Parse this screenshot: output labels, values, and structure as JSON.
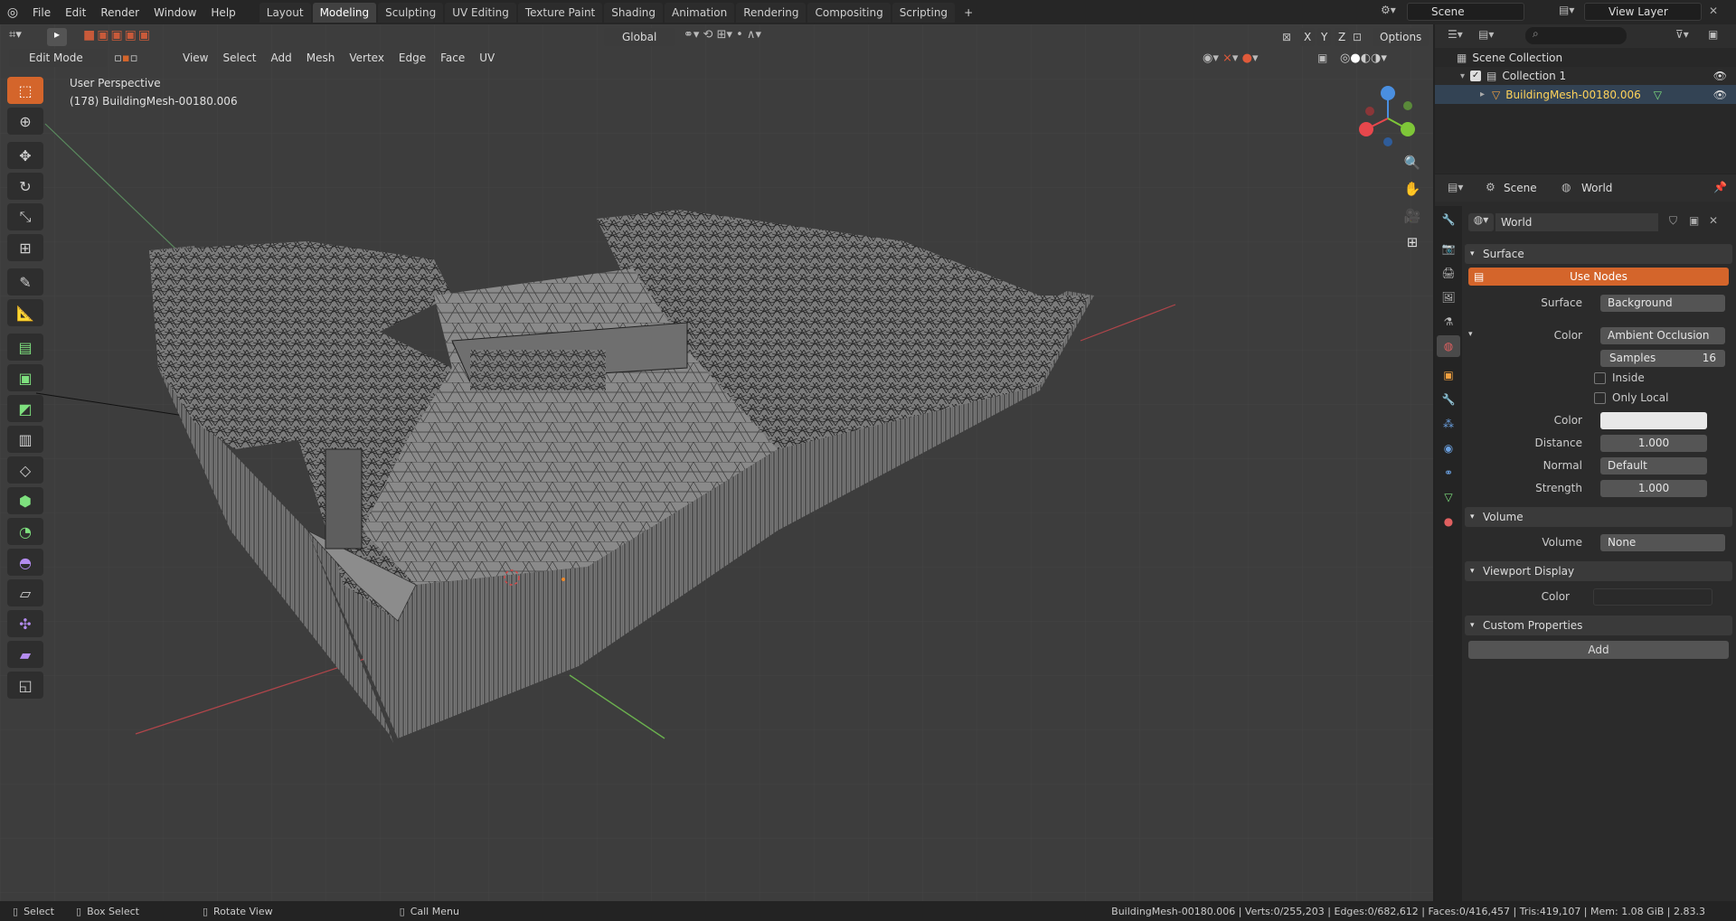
{
  "topbar": {
    "menus": [
      "File",
      "Edit",
      "Render",
      "Window",
      "Help"
    ],
    "workspaces": [
      "Layout",
      "Modeling",
      "Sculpting",
      "UV Editing",
      "Texture Paint",
      "Shading",
      "Animation",
      "Rendering",
      "Compositing",
      "Scripting"
    ],
    "active_workspace": "Modeling",
    "add_tab": "+",
    "scene_name": "Scene",
    "view_layer": "View Layer"
  },
  "viewport": {
    "mode": "Edit Mode",
    "menus": [
      "View",
      "Select",
      "Add",
      "Mesh",
      "Vertex",
      "Edge",
      "Face",
      "UV"
    ],
    "orientation": "Global",
    "options": "Options",
    "axes": [
      "X",
      "Y",
      "Z"
    ],
    "perspective": "User Perspective",
    "object_label": "(178) BuildingMesh-00180.006",
    "gizmo": {
      "x": "X",
      "y": "Y",
      "z": "Z"
    }
  },
  "outliner": {
    "root": "Scene Collection",
    "collection": "Collection 1",
    "object": "BuildingMesh-00180.006"
  },
  "properties": {
    "breadcrumb_scene": "Scene",
    "breadcrumb_world": "World",
    "world_name": "World",
    "panels": {
      "surface": {
        "title": "Surface",
        "use_nodes": "Use Nodes",
        "surface_label": "Surface",
        "surface_value": "Background",
        "color_label": "Color",
        "color_value": "Ambient Occlusion",
        "samples_label": "Samples",
        "samples_value": "16",
        "inside_label": "Inside",
        "only_local_label": "Only Local",
        "color2_label": "Color",
        "distance_label": "Distance",
        "distance_value": "1.000",
        "normal_label": "Normal",
        "normal_value": "Default",
        "strength_label": "Strength",
        "strength_value": "1.000"
      },
      "volume": {
        "title": "Volume",
        "label": "Volume",
        "value": "None"
      },
      "viewport_display": {
        "title": "Viewport Display",
        "label": "Color"
      },
      "custom_properties": {
        "title": "Custom Properties",
        "add": "Add"
      }
    }
  },
  "statusbar": {
    "select": "Select",
    "box_select": "Box Select",
    "rotate_view": "Rotate View",
    "call_menu": "Call Menu",
    "stats": "BuildingMesh-00180.006 | Verts:0/255,203 | Edges:0/682,612 | Faces:0/416,457 | Tris:419,107 | Mem: 1.08 GiB | 2.83.3"
  },
  "colors": {
    "accent": "#d4652b",
    "active_object": "#ffd35a",
    "x_axis": "#e8474c",
    "y_axis": "#7ec638",
    "z_axis": "#4a8fe0"
  }
}
